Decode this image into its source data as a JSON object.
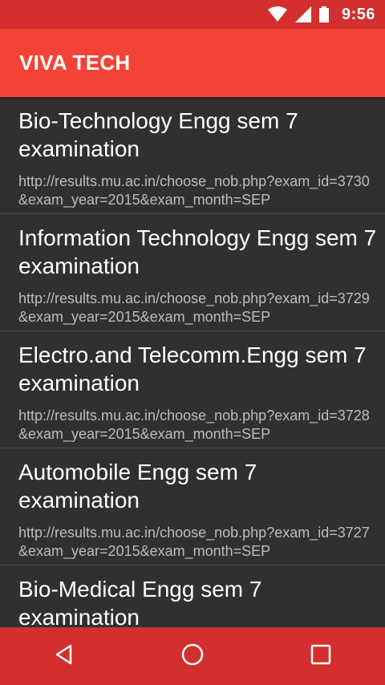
{
  "status_bar": {
    "time": "9:56",
    "icons": [
      "wifi-icon",
      "signal-icon",
      "battery-icon"
    ]
  },
  "app_bar": {
    "title": "VIVA TECH"
  },
  "list": {
    "items": [
      {
        "title": "Bio-Technology Engg sem 7 examination",
        "url": "http://results.mu.ac.in/choose_nob.php?exam_id=3730&exam_year=2015&exam_month=SEP"
      },
      {
        "title": "Information Technology Engg sem 7 examination",
        "url": "http://results.mu.ac.in/choose_nob.php?exam_id=3729&exam_year=2015&exam_month=SEP"
      },
      {
        "title": "Electro.and Telecomm.Engg sem 7 examination",
        "url": "http://results.mu.ac.in/choose_nob.php?exam_id=3728&exam_year=2015&exam_month=SEP"
      },
      {
        "title": "Automobile Engg sem 7 examination",
        "url": "http://results.mu.ac.in/choose_nob.php?exam_id=3727&exam_year=2015&exam_month=SEP"
      },
      {
        "title": "Bio-Medical Engg sem 7 examination",
        "url": ""
      }
    ]
  },
  "nav_bar": {
    "buttons": [
      "back-icon",
      "home-icon",
      "recents-icon"
    ]
  },
  "colors": {
    "status_bar": "#d32f2f",
    "app_bar": "#f44336",
    "background": "#303030",
    "nav_bar": "#d32f2f"
  }
}
